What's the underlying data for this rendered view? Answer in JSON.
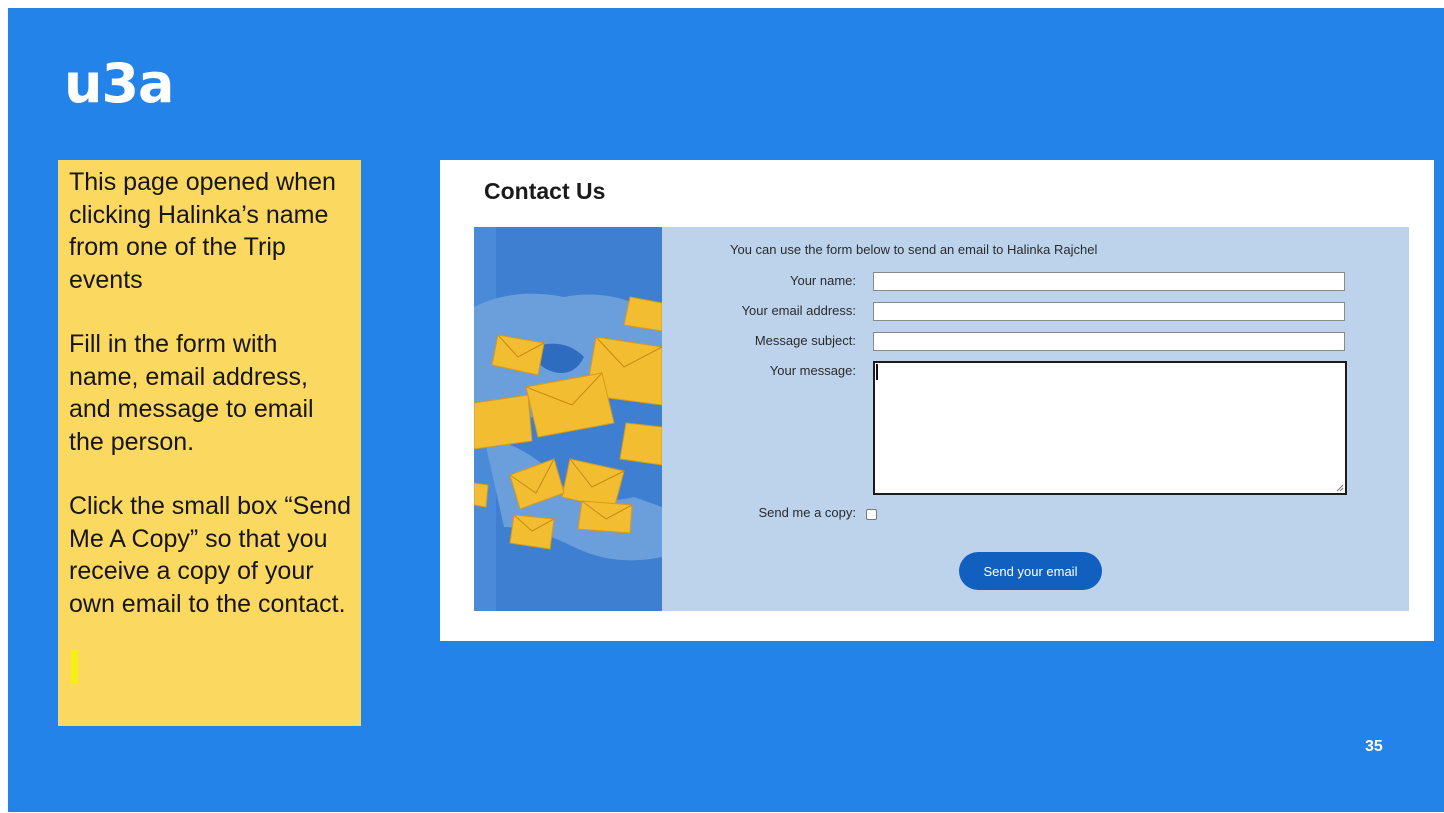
{
  "logo": {
    "text": "u3a"
  },
  "instructions": {
    "paragraphs": [
      "This page opened when clicking Halinka’s name from one of the Trip events",
      "Fill in the form with name, email address, and message to email the person.",
      "Click the small box “Send Me A Copy”  so that you receive a copy of your own email to the contact."
    ]
  },
  "slide": {
    "page_number": "35"
  },
  "contact": {
    "title": "Contact Us",
    "intro": "You can use the form below to send an email to Halinka Rajchel",
    "fields": {
      "name_label": "Your name:",
      "name_value": "",
      "email_label": "Your email address:",
      "email_value": "",
      "subject_label": "Message subject:",
      "subject_value": "",
      "message_label": "Your message:",
      "message_value": ""
    },
    "copy_label": "Send me a copy:",
    "copy_checked": false,
    "send_button": "Send your email"
  },
  "colors": {
    "slide_background": "#2383e8",
    "note_background": "#fbd85f",
    "form_panel": "#bdd3ec",
    "button": "#1160c0",
    "envelope": "#f2bd31"
  },
  "icons": {
    "illustration": "envelopes-over-world-map",
    "checkbox": "checkbox-unchecked"
  }
}
